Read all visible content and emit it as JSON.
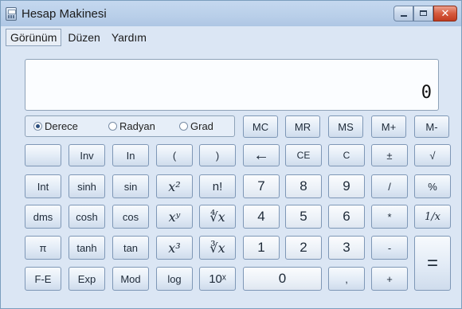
{
  "window": {
    "title": "Hesap Makinesi",
    "close_glyph": "✕"
  },
  "menu": [
    "Görünüm",
    "Düzen",
    "Yardım"
  ],
  "display": {
    "value": "0"
  },
  "angle_modes": {
    "options": [
      "Derece",
      "Radyan",
      "Grad"
    ],
    "selected": "Derece"
  },
  "memory": [
    "MC",
    "MR",
    "MS",
    "M+",
    "M-"
  ],
  "sci_rows": [
    [
      "",
      "Inv",
      "In",
      "(",
      ")"
    ],
    [
      "Int",
      "sinh",
      "sin",
      "x²",
      "n!"
    ],
    [
      "dms",
      "cosh",
      "cos",
      "xʸ",
      "∜x"
    ],
    [
      "π",
      "tanh",
      "tan",
      "x³",
      "∛x"
    ],
    [
      "F-E",
      "Exp",
      "Mod",
      "log",
      "10ˣ"
    ]
  ],
  "std_rows": [
    [
      "←",
      "CE",
      "C",
      "±",
      "√"
    ],
    [
      "7",
      "8",
      "9",
      "/",
      "%"
    ],
    [
      "4",
      "5",
      "6",
      "*",
      "1/x"
    ],
    [
      "1",
      "2",
      "3",
      "-",
      "="
    ],
    [
      "0",
      ",",
      "+"
    ]
  ],
  "colors": {
    "accent": "#dbe6f4",
    "close": "#c13b20"
  }
}
